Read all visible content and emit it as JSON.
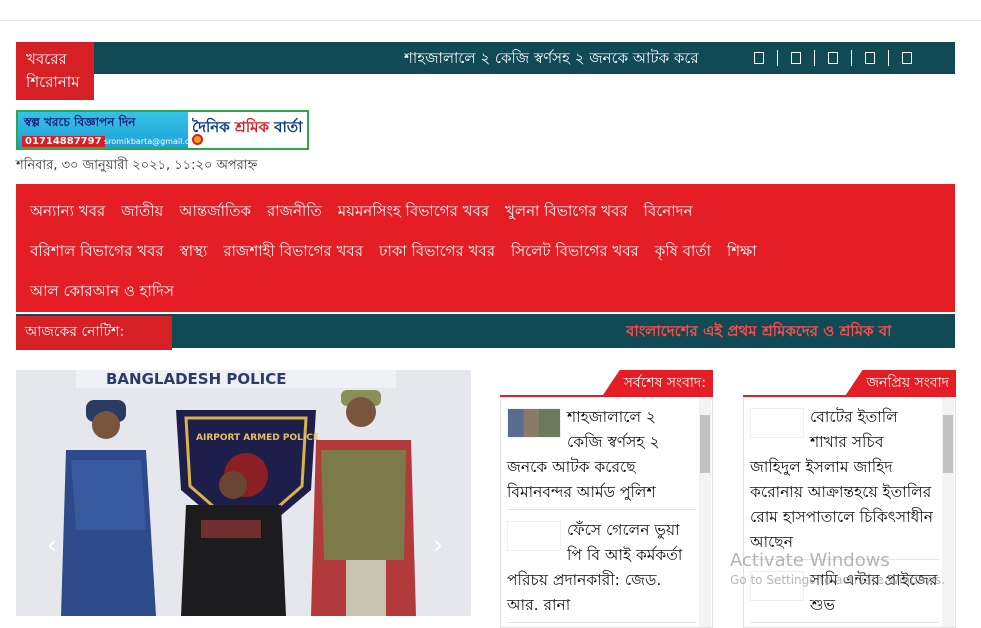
{
  "breaking": {
    "label": "খবরের শিরোনাম",
    "ticker": "শাহজালালে ২ কেজি স্বর্ণসহ ২ জনকে আটক করে",
    "social_icons": [
      "facebook-icon",
      "twitter-icon",
      "linkedin-icon",
      "youtube-icon",
      "pinterest-icon"
    ]
  },
  "ad": {
    "headline": "স্বল্প খরচে বিজ্ঞাপন দিন",
    "phone": "01714887797",
    "email": "sromikbarta@gmail.com",
    "logo_a": "দৈনিক ",
    "logo_b": "শ্রমিক",
    "logo_c": " বার্তা"
  },
  "date_text": "শনিবার, ৩০ জানুয়ারী ২০২১, ১১:২০ অপরাহ্ন",
  "nav": {
    "row1": [
      "অন্যান্য খবর",
      "জাতীয়",
      "আন্তর্জাতিক",
      "রাজনীতি",
      "ময়মনসিংহ বিভাগের খবর",
      "খুলনা বিভাগের খবর",
      "বিনোদন"
    ],
    "row2": [
      "বরিশাল বিভাগের খবর",
      "স্বাস্থ্য",
      "রাজশাহী বিভাগের খবর",
      "ঢাকা বিভাগের খবর",
      "সিলেট বিভাগের খবর",
      "কৃষি বার্তা",
      "শিক্ষা"
    ],
    "row3": [
      "আল কোরআন ও হাদিস"
    ]
  },
  "notice": {
    "label": "আজকের নোটিশ:",
    "ticker": "বাংলাদেশের এই প্রথম শ্রমিকদের ও শ্রমিক বা"
  },
  "slider": {
    "banner": "BANGLADESH POLICE",
    "badge": "AIRPORT ARMED POLICE",
    "prev": "‹",
    "next": "›"
  },
  "latest": {
    "title": "সর্বশেষ সংবাদ:",
    "items": [
      "শাহজালালে ২ কেজি স্বর্ণসহ ২ জনকে আটক করেছে বিমানবন্দর আর্মড পুলিশ",
      "ফেঁসে গেলেন ভুয়া পি বি আই কর্মকর্তা পরিচয় প্রদানকারী: জেড. আর. রানা"
    ]
  },
  "popular": {
    "title": "জনপ্রিয় সংবাদ",
    "items": [
      "বোটের ইতালি শাখার সচিব জাহিদুল ইসলাম জাহিদ করোনায় আক্রান্তহয়ে ইতালির রোম হাসপাতালে চিকিৎসাধীন আছেন",
      "সামি এন্টার প্রাইজের শুভ"
    ]
  },
  "watermark": {
    "line1": "Activate Windows",
    "line2": "Go to Settings to activate Windows."
  }
}
